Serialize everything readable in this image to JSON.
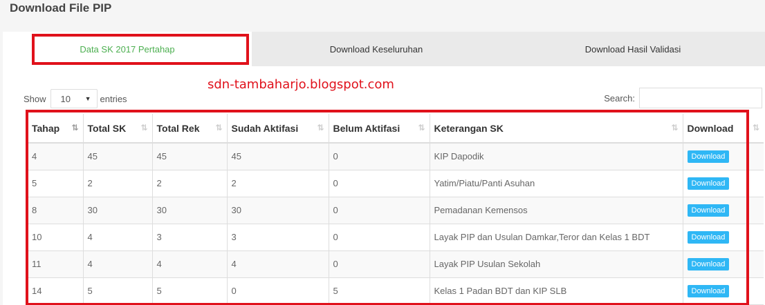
{
  "page_title": "Download File PIP",
  "tabs": [
    {
      "label": "Data SK 2017 Pertahap",
      "active": true
    },
    {
      "label": "Download Keseluruhan",
      "active": false
    },
    {
      "label": "Download Hasil Validasi",
      "active": false
    }
  ],
  "watermark": "sdn-tambaharjo.blogspot.com",
  "length_control": {
    "show_label": "Show",
    "selected": "10",
    "entries_label": "entries"
  },
  "search": {
    "label": "Search:",
    "value": ""
  },
  "table": {
    "headers": [
      "Tahap",
      "Total SK",
      "Total Rek",
      "Sudah Aktifasi",
      "Belum Aktifasi",
      "Keterangan SK",
      "Download"
    ],
    "sorted_column": "Tahap",
    "rows": [
      {
        "tahap": "4",
        "total_sk": "45",
        "total_rek": "45",
        "sudah": "45",
        "belum": "0",
        "keterangan": "KIP Dapodik",
        "button": "Download"
      },
      {
        "tahap": "5",
        "total_sk": "2",
        "total_rek": "2",
        "sudah": "2",
        "belum": "0",
        "keterangan": "Yatim/Piatu/Panti Asuhan",
        "button": "Download"
      },
      {
        "tahap": "8",
        "total_sk": "30",
        "total_rek": "30",
        "sudah": "30",
        "belum": "0",
        "keterangan": "Pemadanan Kemensos",
        "button": "Download"
      },
      {
        "tahap": "10",
        "total_sk": "4",
        "total_rek": "3",
        "sudah": "3",
        "belum": "0",
        "keterangan": "Layak PIP dan Usulan Damkar,Teror dan Kelas 1 BDT",
        "button": "Download"
      },
      {
        "tahap": "11",
        "total_sk": "4",
        "total_rek": "4",
        "sudah": "4",
        "belum": "0",
        "keterangan": "Layak PIP Usulan Sekolah",
        "button": "Download"
      },
      {
        "tahap": "14",
        "total_sk": "5",
        "total_rek": "5",
        "sudah": "0",
        "belum": "5",
        "keterangan": "Kelas 1 Padan BDT dan KIP SLB",
        "button": "Download"
      }
    ]
  },
  "colors": {
    "accent_green": "#4caf50",
    "highlight_red": "#e0111b",
    "button_blue": "#2fb7f5"
  }
}
